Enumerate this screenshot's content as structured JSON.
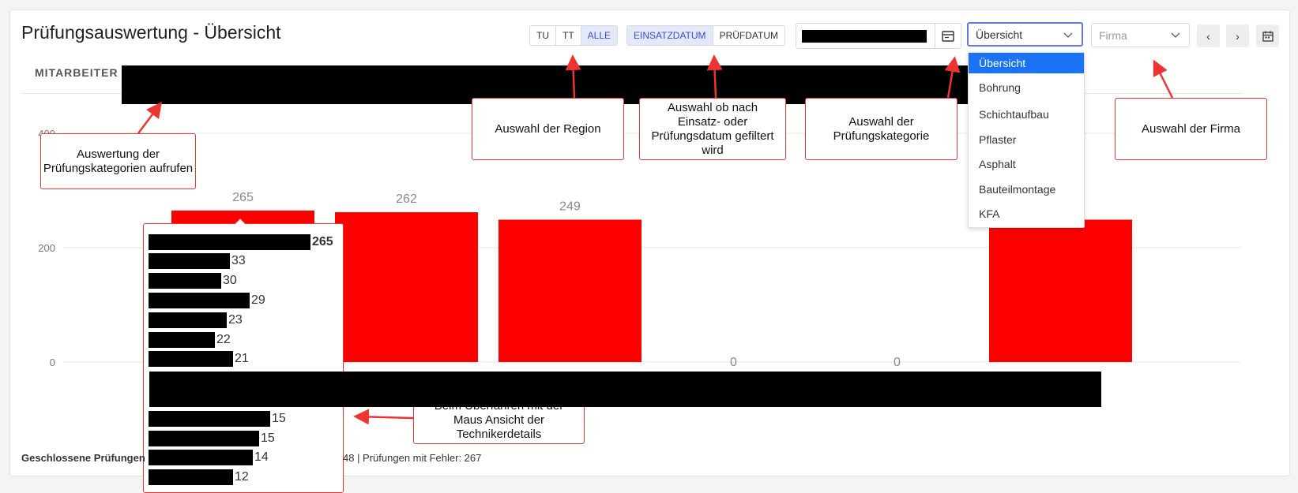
{
  "header": {
    "title": "Prüfungsauswertung - Übersicht",
    "region_toggle": [
      "TU",
      "TT",
      "ALLE"
    ],
    "region_active": "ALLE",
    "date_type_toggle": [
      "EINSATZDATUM",
      "PRÜFDATUM"
    ],
    "date_type_active": "EINSATZDATUM",
    "category_select": "Übersicht",
    "company_placeholder": "Firma",
    "prev_label": "‹",
    "next_label": "›"
  },
  "category_options": [
    "Übersicht",
    "Bohrung",
    "Schichtaufbau",
    "Pflaster",
    "Asphalt",
    "Bauteilmontage",
    "KFA"
  ],
  "tabs": {
    "first": "MITARBEITER"
  },
  "annotations": {
    "categories": "Auswertung der Prüfungskategorien aufrufen",
    "region": "Auswahl der Region",
    "date_filter": "Auswahl ob nach Einsatz- oder Prüfungsdatum gefiltert wird",
    "category": "Auswahl der Prüfungskategorie",
    "company": "Auswahl der Firma",
    "hover": "Beim Überfahren mit der Maus Ansicht der Technikerdetails"
  },
  "chart_data": {
    "type": "bar",
    "categories": [
      "",
      "",
      "",
      "",
      "",
      ""
    ],
    "values": [
      265,
      262,
      249,
      0,
      0,
      249
    ],
    "ylim": [
      0,
      400
    ],
    "yticks": [
      0,
      200,
      400
    ],
    "grid": true,
    "bar_color": "#ff0000"
  },
  "tooltip": {
    "total": "265",
    "rows": [
      "33",
      "30",
      "29",
      "23",
      "22",
      "21",
      "15",
      "15",
      "14",
      "12"
    ]
  },
  "footer": {
    "prefix": "Geschlossene Prüfungen",
    "suffix": "48 | Prüfungen mit Fehler: 267"
  },
  "colors": {
    "accent": "#3a4fd0",
    "annotation": "#e33333",
    "selected": "#1a73f5"
  }
}
